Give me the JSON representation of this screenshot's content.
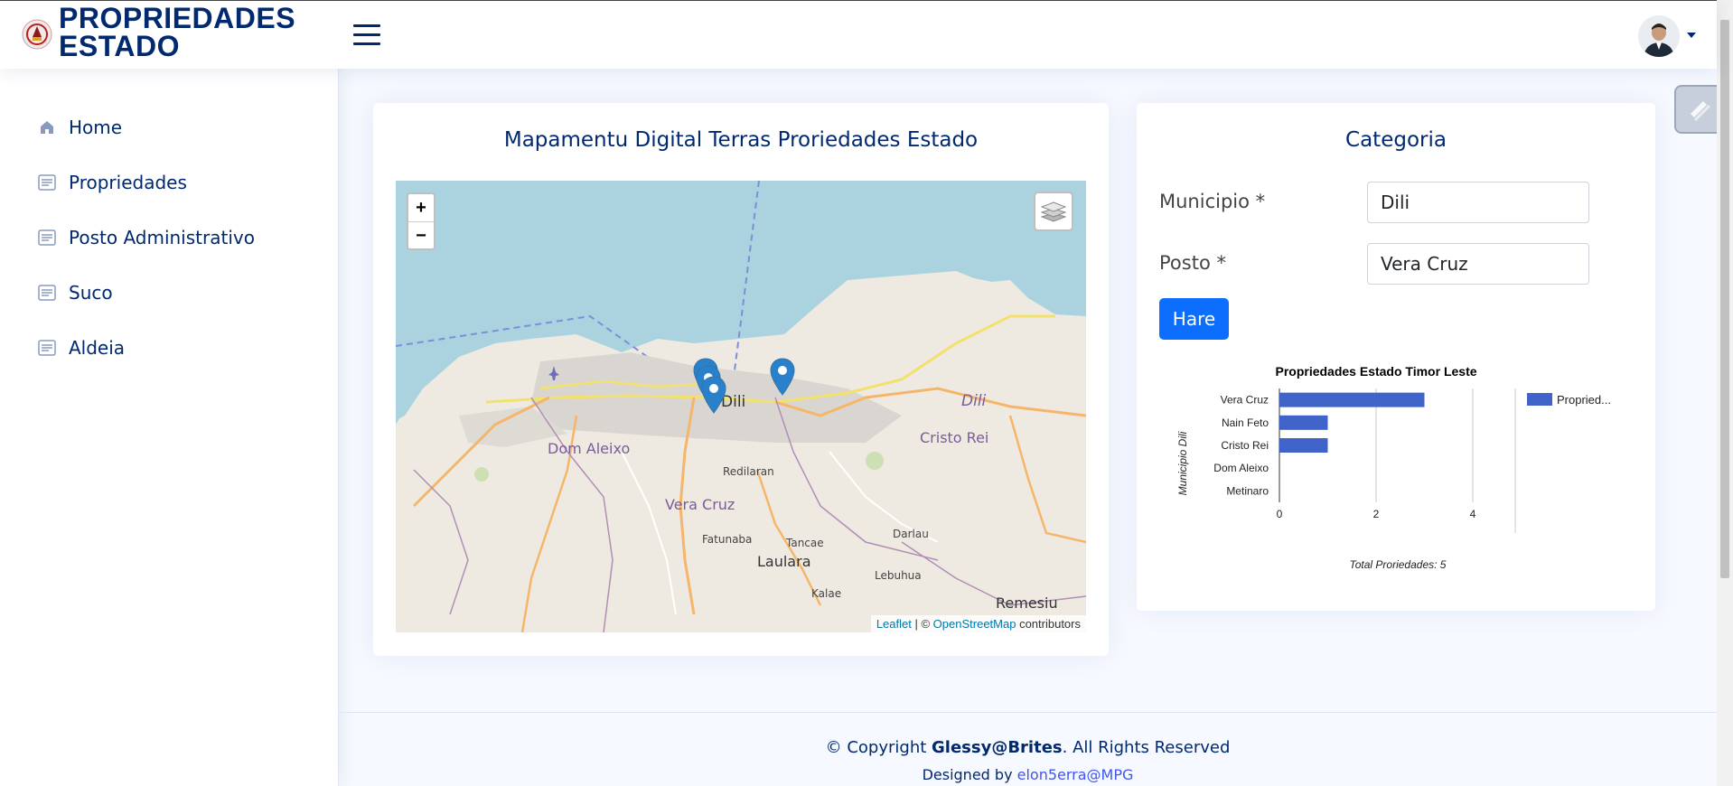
{
  "app": {
    "title_line1": "PROPRIEDADES",
    "title_line2": "ESTADO"
  },
  "header": {
    "menu_icon": "hamburger-icon",
    "avatar_icon": "user-avatar"
  },
  "sidebar": {
    "items": [
      {
        "label": "Home",
        "icon": "home-icon"
      },
      {
        "label": "Propriedades",
        "icon": "list-icon"
      },
      {
        "label": "Posto Administrativo",
        "icon": "list-icon"
      },
      {
        "label": "Suco",
        "icon": "list-icon"
      },
      {
        "label": "Aldeia",
        "icon": "list-icon"
      }
    ]
  },
  "map_card": {
    "title": "Mapamentu Digital Terras Proriedades Estado",
    "zoom_in": "+",
    "zoom_out": "−",
    "attribution": {
      "leaflet": "Leaflet",
      "separator": " | © ",
      "osm": "OpenStreetMap",
      "suffix": " contributors"
    },
    "place_labels": {
      "dili_center": "Dili",
      "dili_region": "Dili",
      "dom_aleixo": "Dom Aleixo",
      "cristo_rei": "Cristo Rei",
      "vera_cruz": "Vera Cruz",
      "laulara": "Laulara",
      "remesiu": "Remesiu",
      "redilaran": "Redilaran",
      "fatunaba": "Fatunaba",
      "tancae": "Tancae",
      "darlau": "Darlau",
      "lebuhua": "Lebuhua",
      "kalae": "Kalae"
    },
    "marker_count": 4
  },
  "category_card": {
    "title": "Categoria",
    "municipio_label": "Municipio *",
    "municipio_value": "Dili",
    "posto_label": "Posto *",
    "posto_value": "Vera Cruz",
    "button_label": "Hare"
  },
  "chart_data": {
    "type": "bar",
    "orientation": "horizontal",
    "title": "Propriedades Estado Timor Leste",
    "ylabel": "Municipio Dili",
    "xlabel": "Total Proriedades: 5",
    "categories": [
      "Vera Cruz",
      "Nain Feto",
      "Cristo Rei",
      "Dom Aleixo",
      "Metinaro"
    ],
    "series": [
      {
        "name": "Propried...",
        "values": [
          3,
          1,
          1,
          0,
          0
        ],
        "color": "#3f63c8"
      }
    ],
    "xlim": [
      0,
      4
    ],
    "xticks": [
      "0",
      "2",
      "4"
    ],
    "legend_position": "right",
    "grid": true
  },
  "footer": {
    "copyright_prefix": "© Copyright ",
    "copyright_owner": "Glessy@Brites",
    "copyright_suffix": ". All Rights Reserved",
    "designed_prefix": "Designed by ",
    "designed_by": "elon5erra@MPG"
  },
  "colors": {
    "primary": "#012970",
    "button": "#0d6efd",
    "bar": "#3f63c8",
    "water": "#aad3df"
  }
}
